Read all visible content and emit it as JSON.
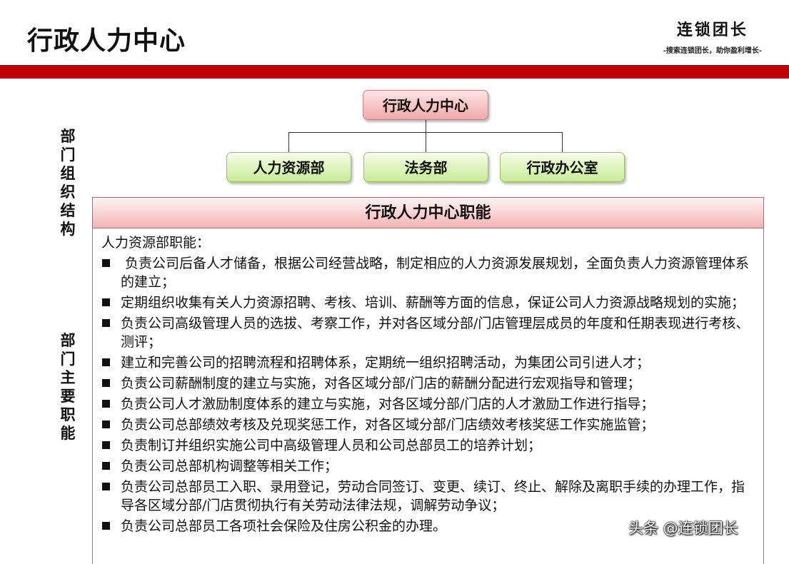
{
  "header": {
    "title": "行政人力中心",
    "brand_name": "连锁团长",
    "brand_slogan": "-搜索连锁团长，助你盈利增长-"
  },
  "side_labels": {
    "structure": [
      "部",
      "门",
      "组",
      "织",
      "结",
      "构"
    ],
    "duties": [
      "部",
      "门",
      "主",
      "要",
      "职",
      "能"
    ]
  },
  "org_chart": {
    "root": "行政人力中心",
    "children": [
      "人力资源部",
      "法务部",
      "行政办公室"
    ]
  },
  "duties": {
    "header": "行政人力中心职能",
    "intro": "人力资源部职能：",
    "items": [
      " 负责公司后备人才储备，根据公司经营战略，制定相应的人力资源发展规划，全面负责人力资源管理体系的建立；",
      "定期组织收集有关人力资源招聘、考核、培训、薪酬等方面的信息，保证公司人力资源战略规划的实施；",
      "负责公司高级管理人员的选拔、考察工作，并对各区域分部/门店管理层成员的年度和任期表现进行考核、测评；",
      "建立和完善公司的招聘流程和招聘体系，定期统一组织招聘活动，为集团公司引进人才；",
      "负责公司薪酬制度的建立与实施，对各区域分部/门店的薪酬分配进行宏观指导和管理；",
      "负责公司人才激励制度体系的建立与实施，对各区域分部/门店的人才激励工作进行指导；",
      "负责公司总部绩效考核及兑现奖惩工作，对各区域分部/门店绩效考核奖惩工作实施监管；",
      "负责制订并组织实施公司中高级管理人员和公司总部员工的培养计划；",
      "负责公司总部机构调整等相关工作；",
      "负责公司总部员工入职、录用登记，劳动合同签订、变更、续订、终止、解除及离职手续的办理工作，指导各区域分部/门店贯彻执行有关劳动法律法规，调解劳动争议；",
      "负责公司总部员工各项社会保险及住房公积金的办理。"
    ]
  },
  "watermark": "头条 @连锁团长",
  "colors": {
    "band": "#c00000",
    "root_box": "#f1a9a9",
    "child_box": "#c8ec95",
    "duty_header": "#f4b3b3"
  }
}
